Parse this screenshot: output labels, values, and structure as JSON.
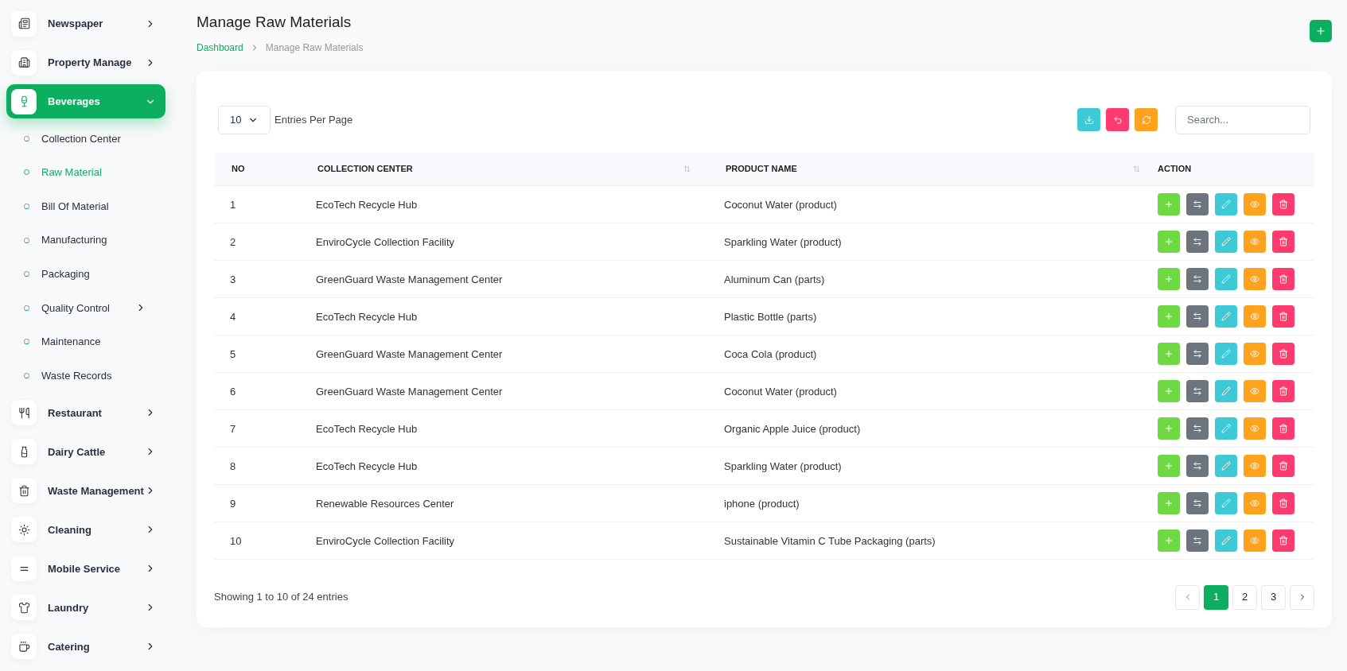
{
  "sidebar": {
    "items": [
      {
        "label": "Newspaper",
        "expanded": false,
        "selected": false
      },
      {
        "label": "Property Manage",
        "expanded": false,
        "selected": false
      },
      {
        "label": "Beverages",
        "expanded": true,
        "selected": true,
        "children": [
          {
            "label": "Collection Center",
            "selected": false,
            "kind": "link"
          },
          {
            "label": "Raw Material",
            "selected": true,
            "kind": "link"
          },
          {
            "label": "Bill Of Material",
            "selected": false,
            "kind": "link"
          },
          {
            "label": "Manufacturing",
            "selected": false,
            "kind": "link"
          },
          {
            "label": "Packaging",
            "selected": false,
            "kind": "link"
          },
          {
            "label": "Quality Control",
            "selected": false,
            "kind": "submenu"
          },
          {
            "label": "Maintenance",
            "selected": false,
            "kind": "link"
          },
          {
            "label": "Waste Records",
            "selected": false,
            "kind": "link"
          }
        ]
      },
      {
        "label": "Restaurant",
        "expanded": false,
        "selected": false
      },
      {
        "label": "Dairy Cattle",
        "expanded": false,
        "selected": false
      },
      {
        "label": "Waste Management",
        "expanded": false,
        "selected": false
      },
      {
        "label": "Cleaning",
        "expanded": false,
        "selected": false
      },
      {
        "label": "Mobile Service",
        "expanded": false,
        "selected": false
      },
      {
        "label": "Laundry",
        "expanded": false,
        "selected": false
      },
      {
        "label": "Catering",
        "expanded": false,
        "selected": false
      }
    ]
  },
  "header": {
    "title": "Manage Raw Materials",
    "breadcrumb": [
      "Dashboard",
      "Manage Raw Materials"
    ]
  },
  "toolbar": {
    "entries": "10",
    "entries_label": "Entries Per Page",
    "search": {
      "placeholder": "Search..."
    }
  },
  "table": {
    "columns": [
      {
        "label": "NO",
        "sortable": false
      },
      {
        "label": "COLLECTION CENTER",
        "sortable": true
      },
      {
        "label": "PRODUCT NAME",
        "sortable": true
      },
      {
        "label": "ACTION",
        "sortable": false
      }
    ],
    "rows": [
      [
        "1",
        "EcoTech Recycle Hub",
        "Coconut Water (product)"
      ],
      [
        "2",
        "EnviroCycle Collection Facility",
        "Sparkling Water (product)"
      ],
      [
        "3",
        "GreenGuard Waste Management Center",
        "Aluminum Can (parts)"
      ],
      [
        "4",
        "EcoTech Recycle Hub",
        "Plastic Bottle (parts)"
      ],
      [
        "5",
        "GreenGuard Waste Management Center",
        "Coca Cola (product)"
      ],
      [
        "6",
        "GreenGuard Waste Management Center",
        "Coconut Water (product)"
      ],
      [
        "7",
        "EcoTech Recycle Hub",
        "Organic Apple Juice (product)"
      ],
      [
        "8",
        "EcoTech Recycle Hub",
        "Sparkling Water (product)"
      ],
      [
        "9",
        "Renewable Resources Center",
        "iphone (product)"
      ],
      [
        "10",
        "EnviroCycle Collection Facility",
        "Sustainable Vitamin C Tube Packaging (parts)"
      ]
    ]
  },
  "footer": {
    "summary": "Showing 1 to 10 of 24 entries",
    "pages": [
      {
        "label": "1",
        "selected": true
      },
      {
        "label": "2",
        "selected": false
      },
      {
        "label": "3",
        "selected": false
      }
    ]
  }
}
